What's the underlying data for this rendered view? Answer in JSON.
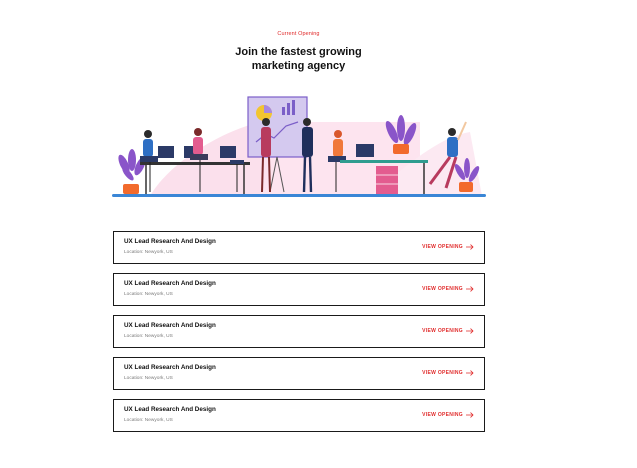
{
  "section": {
    "eyebrow": "Current Opening",
    "headline_line1": "Join the fastest growing",
    "headline_line2": "marketing agency"
  },
  "colors": {
    "accent": "#e02b2b",
    "text": "#121212",
    "muted": "#7a7a7a",
    "border": "#1a1a1a"
  },
  "jobs": [
    {
      "title": "UX Lead Research And Design",
      "location": "Location: Newyork, US",
      "cta": "VIEW OPENING",
      "icon": "arrow-right-icon"
    },
    {
      "title": "UX Lead Research And Design",
      "location": "Location: Newyork, US",
      "cta": "VIEW OPENING",
      "icon": "arrow-right-icon"
    },
    {
      "title": "UX Lead Research And Design",
      "location": "Location: Newyork, US",
      "cta": "VIEW OPENING",
      "icon": "arrow-right-icon"
    },
    {
      "title": "UX Lead Research And Design",
      "location": "Location: Newyork, US",
      "cta": "VIEW OPENING",
      "icon": "arrow-right-icon"
    },
    {
      "title": "UX Lead Research And Design",
      "location": "Location: Newyork, US",
      "cta": "VIEW OPENING",
      "icon": "arrow-right-icon"
    }
  ]
}
